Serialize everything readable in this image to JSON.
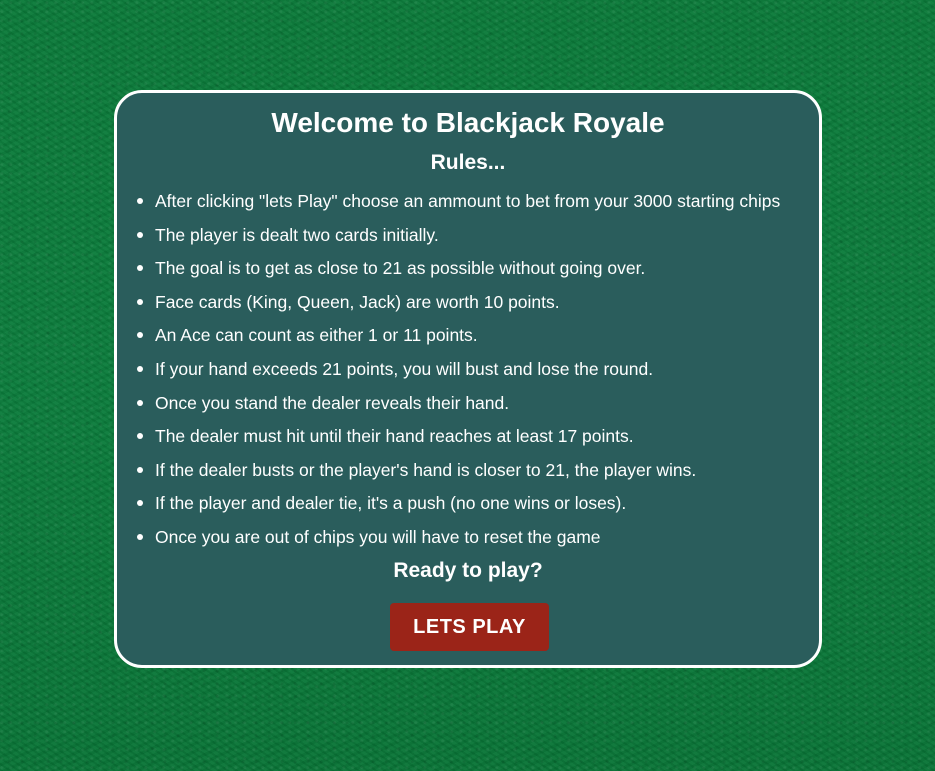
{
  "welcome": {
    "title": "Welcome to Blackjack Royale",
    "rules_heading": "Rules...",
    "rules": [
      "After clicking \"lets Play\" choose an ammount to bet from your 3000 starting chips",
      "The player is dealt two cards initially.",
      "The goal is to get as close to 21 as possible without going over.",
      "Face cards (King, Queen, Jack) are worth 10 points.",
      "An Ace can count as either 1 or 11 points.",
      "If your hand exceeds 21 points, you will bust and lose the round.",
      "Once you stand the dealer reveals their hand.",
      "The dealer must hit until their hand reaches at least 17 points.",
      "If the dealer busts or the player's hand is closer to 21, the player wins.",
      "If the player and dealer tie, it's a push (no one wins or loses).",
      "Once you are out of chips you will have to reset the game"
    ],
    "ready_text": "Ready to play?",
    "play_button_label": "LETS PLAY"
  },
  "colors": {
    "table_felt": "#0b7a3a",
    "panel_background": "#2a5d5c",
    "panel_border": "#ffffff",
    "button_background": "#9b2418",
    "text": "#ffffff"
  }
}
